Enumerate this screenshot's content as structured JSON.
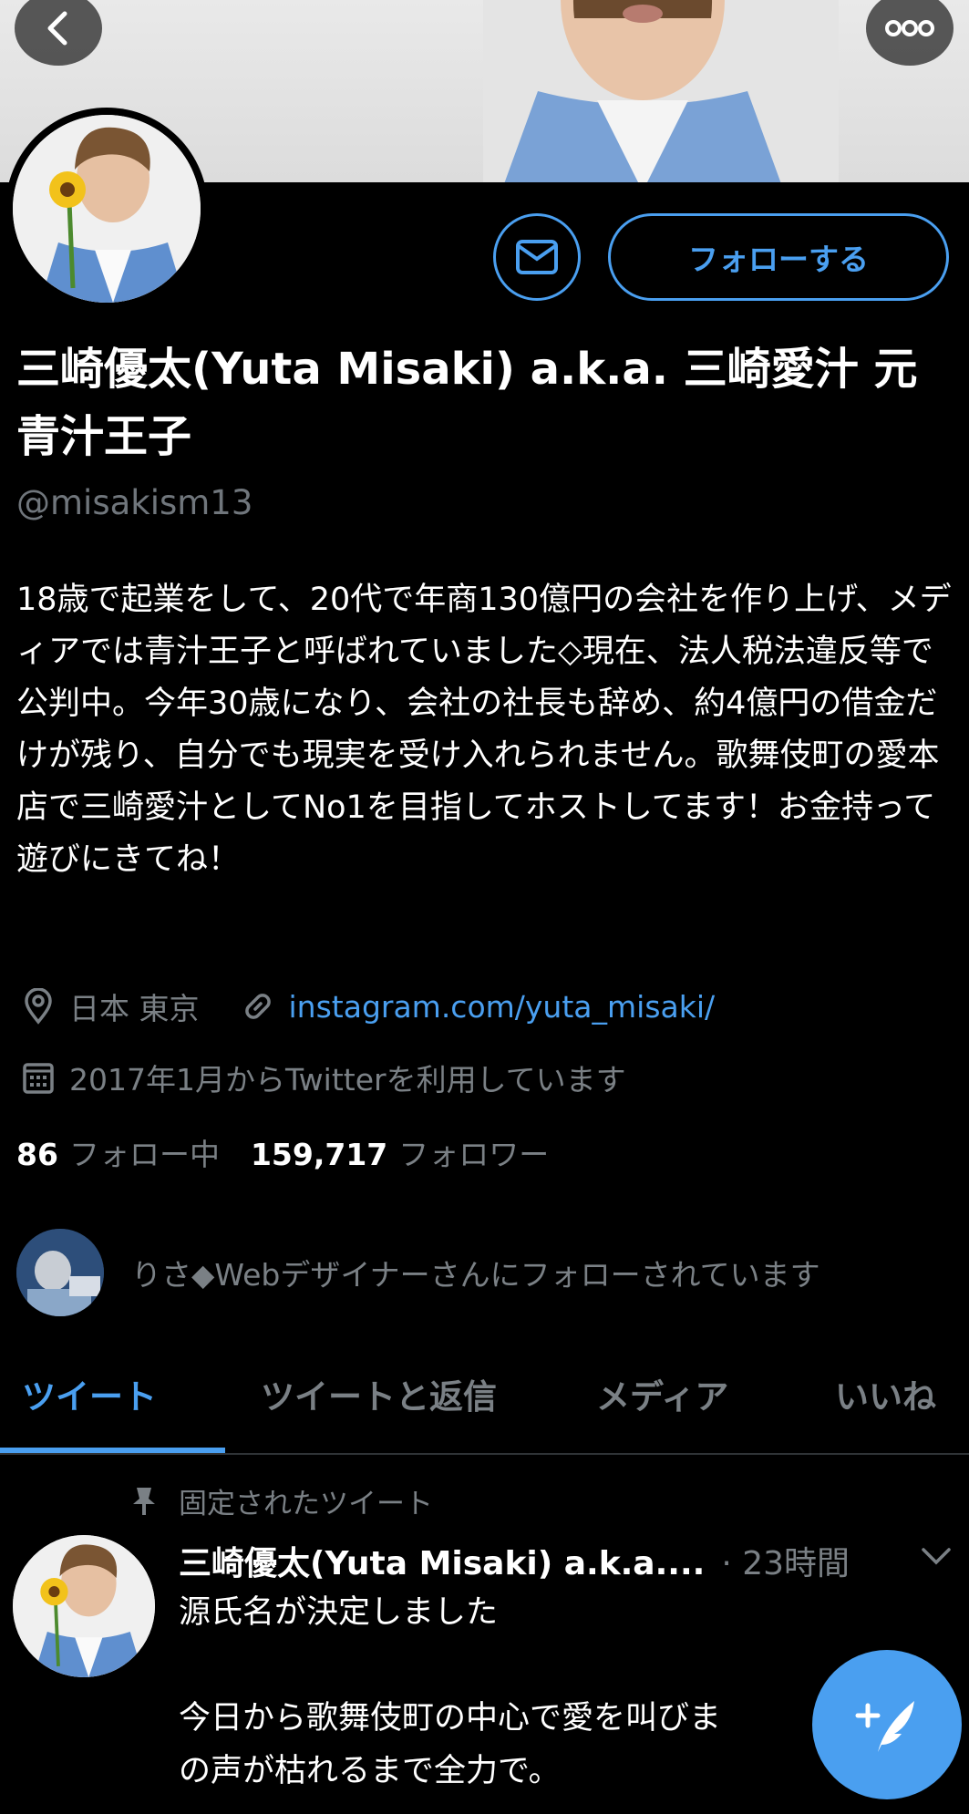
{
  "profile": {
    "name": "三崎優太(Yuta Misaki) a.k.a. 三崎愛汁 元青汁王子",
    "handle": "@misakism13",
    "bio": "18歳で起業をして、20代で年商130億円の会社を作り上げ、メディアでは青汁王子と呼ばれていました◇現在、法人税法違反等で公判中。今年30歳になり、会社の社長も辞め、約4億円の借金だけが残り、自分でも現実を受け入れられません。歌舞伎町の愛本店で三崎愛汁としてNo1を目指してホストしてます！お金持って遊びにきてね！",
    "location": "日本 東京",
    "website": "instagram.com/yuta_misaki/",
    "joined": "2017年1月からTwitterを利用しています",
    "following_count": "86",
    "following_label": "フォロー中",
    "followers_count": "159,717",
    "followers_label": "フォロワー",
    "followed_by": "りさ◆Webデザイナーさんにフォローされています"
  },
  "actions": {
    "follow_label": "フォローする",
    "message_icon": "envelope-icon"
  },
  "tabs": [
    {
      "label": "ツイート",
      "active": true
    },
    {
      "label": "ツイートと返信",
      "active": false
    },
    {
      "label": "メディア",
      "active": false
    },
    {
      "label": "いいね",
      "active": false
    }
  ],
  "pinned_tweet": {
    "pinned_label": "固定されたツイート",
    "author": "三崎優太(Yuta Misaki) a.k.a....",
    "time": "· 23時間",
    "text": "源氏名が決定しました\n\n今日から歌舞伎町の中心で愛を叫びま\nの声が枯れるまで全力で。"
  },
  "colors": {
    "accent": "#4a9ff0",
    "background": "#000000",
    "secondary_text": "#7a8085"
  }
}
